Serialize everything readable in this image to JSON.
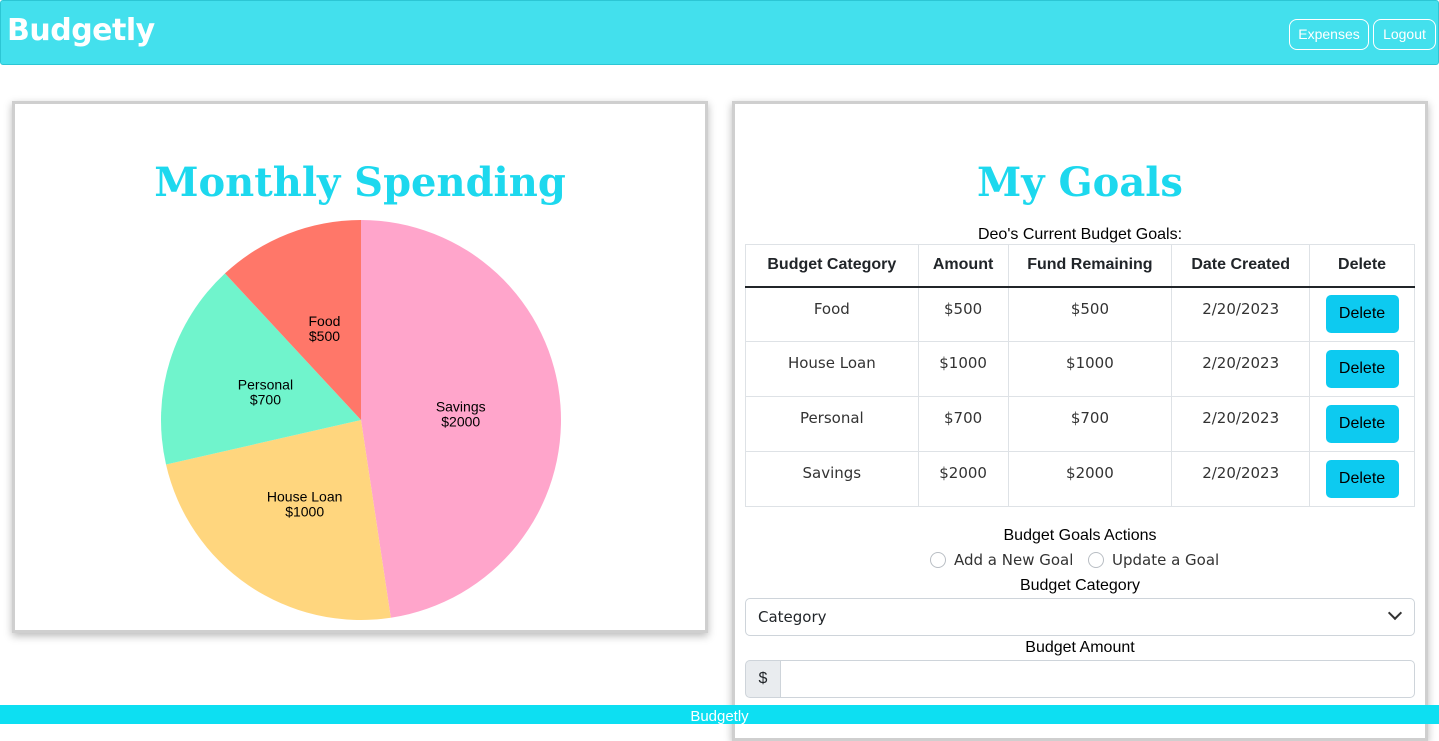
{
  "app": {
    "brand": "Budgetly",
    "nav": {
      "expenses_label": "Expenses",
      "logout_label": "Logout"
    },
    "accent_color": "#43e0ed",
    "title_color": "#1dd8ee"
  },
  "spending": {
    "title": "Monthly Spending",
    "chart_data": {
      "type": "pie",
      "slices": [
        {
          "label": "Savings",
          "value": 2000,
          "value_label": "$2000",
          "color": "#ffa5cb"
        },
        {
          "label": "House Loan",
          "value": 1000,
          "value_label": "$1000",
          "color": "#ffd67e"
        },
        {
          "label": "Personal",
          "value": 700,
          "value_label": "$700",
          "color": "#70f4cc"
        },
        {
          "label": "Food",
          "value": 500,
          "value_label": "$500",
          "color": "#ff7769"
        }
      ]
    }
  },
  "goals": {
    "title": "My Goals",
    "caption": "Deo's Current Budget Goals:",
    "columns": [
      "Budget Category",
      "Amount",
      "Fund Remaining",
      "Date Created",
      "Delete"
    ],
    "rows": [
      {
        "category": "Food",
        "amount": "$500",
        "remaining": "$500",
        "date": "2/20/2023",
        "delete_label": "Delete"
      },
      {
        "category": "House Loan",
        "amount": "$1000",
        "remaining": "$1000",
        "date": "2/20/2023",
        "delete_label": "Delete"
      },
      {
        "category": "Personal",
        "amount": "$700",
        "remaining": "$700",
        "date": "2/20/2023",
        "delete_label": "Delete"
      },
      {
        "category": "Savings",
        "amount": "$2000",
        "remaining": "$2000",
        "date": "2/20/2023",
        "delete_label": "Delete"
      }
    ],
    "form": {
      "actions_label": "Budget Goals Actions",
      "radio_add": "Add a New Goal",
      "radio_update": "Update a Goal",
      "category_label": "Budget Category",
      "category_selected": "Category",
      "amount_label": "Budget Amount",
      "currency_symbol": "$",
      "amount_value": ""
    }
  },
  "footer": {
    "text": "Budgetly"
  }
}
